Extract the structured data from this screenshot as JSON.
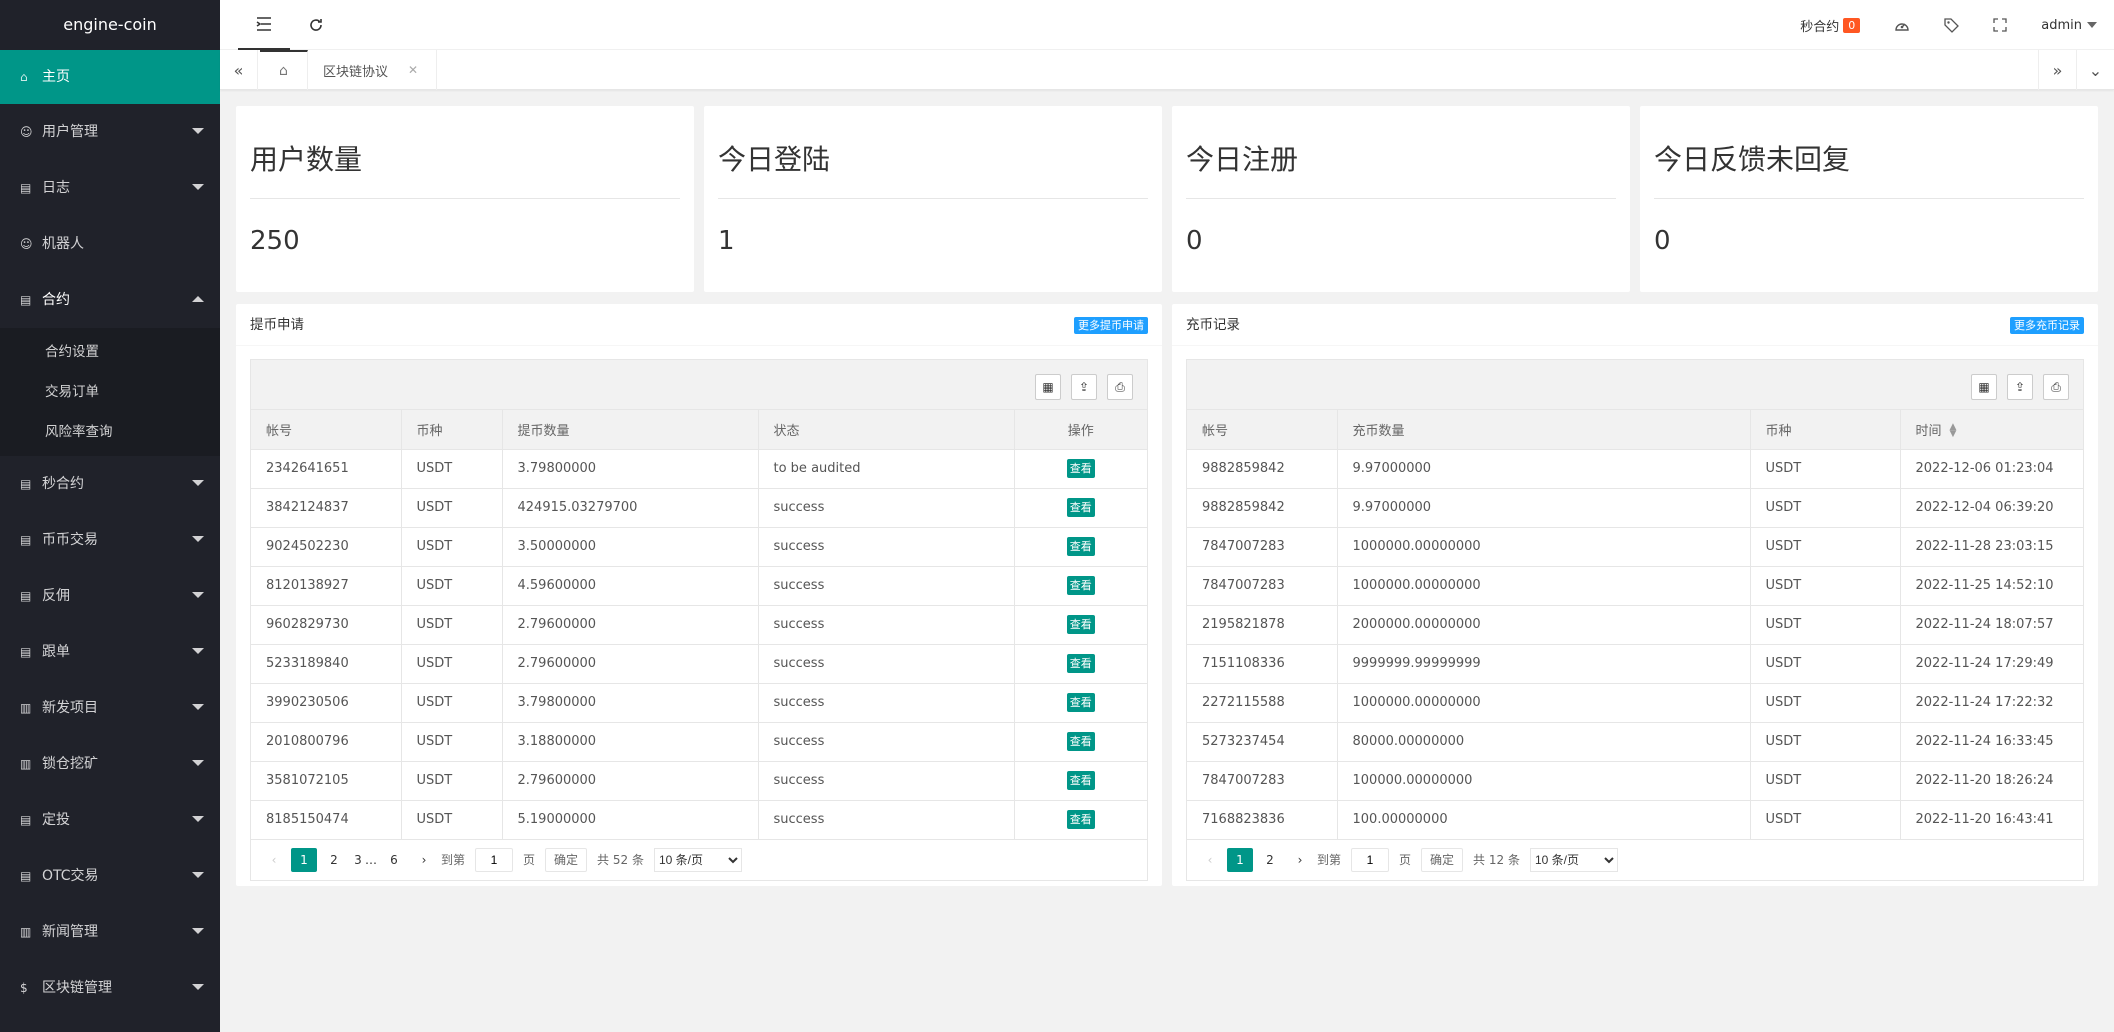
{
  "app": {
    "logo": "engine-coin"
  },
  "sidebar": {
    "items": [
      {
        "label": "主页",
        "icon": "home-icon"
      },
      {
        "label": "用户管理",
        "icon": "user-icon"
      },
      {
        "label": "日志",
        "icon": "file-icon"
      },
      {
        "label": "机器人",
        "icon": "user-icon"
      },
      {
        "label": "合约",
        "icon": "file-icon"
      },
      {
        "label": "秒合约",
        "icon": "file-icon"
      },
      {
        "label": "币币交易",
        "icon": "file-icon"
      },
      {
        "label": "反佣",
        "icon": "file-icon"
      },
      {
        "label": "跟单",
        "icon": "file-icon"
      },
      {
        "label": "新发项目",
        "icon": "chart-icon"
      },
      {
        "label": "锁仓挖矿",
        "icon": "chart-icon"
      },
      {
        "label": "定投",
        "icon": "file-icon"
      },
      {
        "label": "OTC交易",
        "icon": "file-icon"
      },
      {
        "label": "新闻管理",
        "icon": "chart-icon"
      },
      {
        "label": "区块链管理",
        "icon": "dollar-icon"
      }
    ],
    "sub": [
      "合约设置",
      "交易订单",
      "风险率查询"
    ]
  },
  "header": {
    "second_contract": "秒合约",
    "badge": "0",
    "user": "admin"
  },
  "tabs": {
    "current": "区块链协议"
  },
  "stats": [
    {
      "title": "用户数量",
      "value": "250"
    },
    {
      "title": "今日登陆",
      "value": "1"
    },
    {
      "title": "今日注册",
      "value": "0"
    },
    {
      "title": "今日反馈未回复",
      "value": "0"
    }
  ],
  "withdraw": {
    "title": "提币申请",
    "more": "更多提币申请",
    "columns": [
      "帐号",
      "币种",
      "提币数量",
      "状态",
      "操作"
    ],
    "view_label": "查看",
    "rows": [
      [
        "2342641651",
        "USDT",
        "3.79800000",
        "to be audited"
      ],
      [
        "3842124837",
        "USDT",
        "424915.03279700",
        "success"
      ],
      [
        "9024502230",
        "USDT",
        "3.50000000",
        "success"
      ],
      [
        "8120138927",
        "USDT",
        "4.59600000",
        "success"
      ],
      [
        "9602829730",
        "USDT",
        "2.79600000",
        "success"
      ],
      [
        "5233189840",
        "USDT",
        "2.79600000",
        "success"
      ],
      [
        "3990230506",
        "USDT",
        "3.79800000",
        "success"
      ],
      [
        "2010800796",
        "USDT",
        "3.18800000",
        "success"
      ],
      [
        "3581072105",
        "USDT",
        "2.79600000",
        "success"
      ],
      [
        "8185150474",
        "USDT",
        "5.19000000",
        "success"
      ]
    ],
    "pager": {
      "pages": [
        "1",
        "2",
        "3",
        "…",
        "6"
      ],
      "goto": "到第",
      "page_value": "1",
      "page_unit": "页",
      "ok": "确定",
      "total": "共 52 条",
      "per_page": "10 条/页"
    }
  },
  "recharge": {
    "title": "充币记录",
    "more": "更多充币记录",
    "columns": [
      "帐号",
      "充币数量",
      "币种",
      "时间"
    ],
    "rows": [
      [
        "9882859842",
        "9.97000000",
        "USDT",
        "2022-12-06 01:23:04"
      ],
      [
        "9882859842",
        "9.97000000",
        "USDT",
        "2022-12-04 06:39:20"
      ],
      [
        "7847007283",
        "1000000.00000000",
        "USDT",
        "2022-11-28 23:03:15"
      ],
      [
        "7847007283",
        "1000000.00000000",
        "USDT",
        "2022-11-25 14:52:10"
      ],
      [
        "2195821878",
        "2000000.00000000",
        "USDT",
        "2022-11-24 18:07:57"
      ],
      [
        "7151108336",
        "9999999.99999999",
        "USDT",
        "2022-11-24 17:29:49"
      ],
      [
        "2272115588",
        "1000000.00000000",
        "USDT",
        "2022-11-24 17:22:32"
      ],
      [
        "5273237454",
        "80000.00000000",
        "USDT",
        "2022-11-24 16:33:45"
      ],
      [
        "7847007283",
        "100000.00000000",
        "USDT",
        "2022-11-20 18:26:24"
      ],
      [
        "7168823836",
        "100.00000000",
        "USDT",
        "2022-11-20 16:43:41"
      ]
    ],
    "pager": {
      "pages": [
        "1",
        "2"
      ],
      "goto": "到第",
      "page_value": "1",
      "page_unit": "页",
      "ok": "确定",
      "total": "共 12 条",
      "per_page": "10 条/页"
    }
  },
  "colors": {
    "accent": "#009688",
    "blue": "#1e9fff",
    "sidebar": "#20222a",
    "badge": "#ff5722"
  }
}
